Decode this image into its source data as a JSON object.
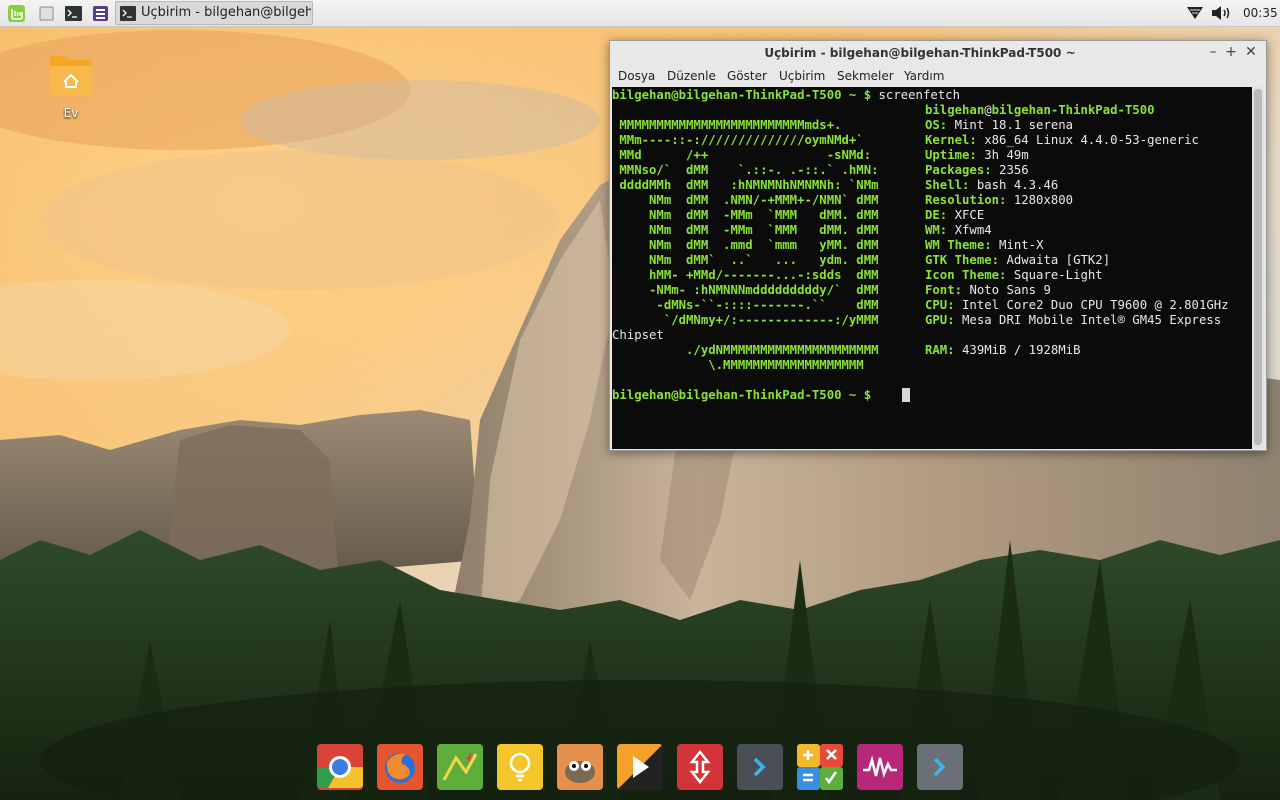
{
  "panel": {
    "launchers": [
      {
        "name": "mint-menu-icon"
      },
      {
        "name": "show-desktop-icon"
      },
      {
        "name": "terminal-launcher-icon"
      },
      {
        "name": "app-launcher-icon"
      }
    ],
    "task_label": "Uçbirim - bilgehan@bilgeha...",
    "clock": "00:35"
  },
  "desktop": {
    "home_folder_label": "Ev"
  },
  "terminal": {
    "title": "Uçbirim - bilgehan@bilgehan-ThinkPad-T500 ~",
    "menu": [
      "Dosya",
      "Düzenle",
      "Göster",
      "Uçbirim",
      "Sekmeler",
      "Yardım"
    ],
    "prompt": "bilgehan@bilgehan-ThinkPad-T500 ~ $",
    "command": "screenfetch",
    "user": "bilgehan",
    "at": "@",
    "host": "bilgehan-ThinkPad-T500",
    "logo": [
      "",
      " MMMMMMMMMMMMMMMMMMMMMMMMMmds+.",
      " MMm----::-://////////////oymNMd+`",
      " MMd      /++                -sNMd:",
      " MMNso/`  dMM    `.::-. .-::.` .hMN:",
      " ddddMMh  dMM   :hNMNMNhNMNMNh: `NMm",
      "     NMm  dMM  .NMN/-+MMM+-/NMN` dMM",
      "     NMm  dMM  -MMm  `MMM   dMM. dMM",
      "     NMm  dMM  -MMm  `MMM   dMM. dMM",
      "     NMm  dMM  .mmd  `mmm   yMM. dMM",
      "     NMm  dMM`  ..`   ...   ydm. dMM",
      "     hMM- +MMd/-------...-:sdds  dMM",
      "     -NMm- :hNMNNNmdddddddddy/`  dMM",
      "      -dMNs-``-::::-------.``    dMM",
      "       `/dMNmy+/:-------------:/yMMM",
      "",
      "          ./ydNMMMMMMMMMMMMMMMMMMMMM",
      "             \\.MMMMMMMMMMMMMMMMMMM"
    ],
    "info": [
      {
        "label": "OS:",
        "value": "Mint 18.1 serena"
      },
      {
        "label": "Kernel:",
        "value": "x86_64 Linux 4.4.0-53-generic"
      },
      {
        "label": "Uptime:",
        "value": "3h 49m"
      },
      {
        "label": "Packages:",
        "value": "2356"
      },
      {
        "label": "Shell:",
        "value": "bash 4.3.46"
      },
      {
        "label": "Resolution:",
        "value": "1280x800"
      },
      {
        "label": "DE:",
        "value": "XFCE"
      },
      {
        "label": "WM:",
        "value": "Xfwm4"
      },
      {
        "label": "WM Theme:",
        "value": "Mint-X"
      },
      {
        "label": "GTK Theme:",
        "value": "Adwaita [GTK2]"
      },
      {
        "label": "Icon Theme:",
        "value": "Square-Light"
      },
      {
        "label": "Font:",
        "value": "Noto Sans 9"
      },
      {
        "label": "CPU:",
        "value": "Intel Core2 Duo CPU T9600 @ 2.801GHz"
      },
      {
        "label": "GPU:",
        "value": "Mesa DRI Mobile Intel® GM45 Express"
      }
    ],
    "wrap_text": "Chipset",
    "ram": {
      "label": "RAM:",
      "value": "439MiB / 1928MiB"
    }
  },
  "dock": {
    "apps": [
      {
        "name": "chrome-icon"
      },
      {
        "name": "firefox-icon"
      },
      {
        "name": "maps-icon"
      },
      {
        "name": "lightbulb-icon"
      },
      {
        "name": "gimp-icon"
      },
      {
        "name": "media-player-icon"
      },
      {
        "name": "transfer-icon"
      },
      {
        "name": "terminal-dark-icon"
      },
      {
        "name": "calculator-icon"
      },
      {
        "name": "audio-mixer-icon"
      },
      {
        "name": "terminal-grey-icon"
      }
    ]
  },
  "colors": {
    "terminal_green": "#8ae234",
    "terminal_bg": "#0b0b0b",
    "folder_orange": "#f5a623"
  }
}
